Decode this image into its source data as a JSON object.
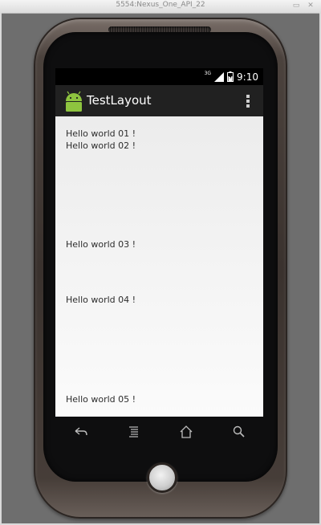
{
  "window": {
    "title": "5554:Nexus_One_API_22"
  },
  "status_bar": {
    "time": "9:10",
    "network": "3G"
  },
  "app_bar": {
    "title": "TestLayout"
  },
  "content": {
    "items": [
      {
        "text": "Hello world 01 !"
      },
      {
        "text": "Hello world 02 !"
      },
      {
        "text": "Hello world 03 !"
      },
      {
        "text": "Hello world 04 !"
      },
      {
        "text": "Hello world 05 !"
      }
    ]
  },
  "nav_bar": {
    "buttons": [
      "back-icon",
      "menu-icon",
      "home-icon",
      "search-icon"
    ]
  },
  "colors": {
    "app_bar": "#212121",
    "android_green": "#8ec43f",
    "content_background": "#f4f4f4"
  }
}
